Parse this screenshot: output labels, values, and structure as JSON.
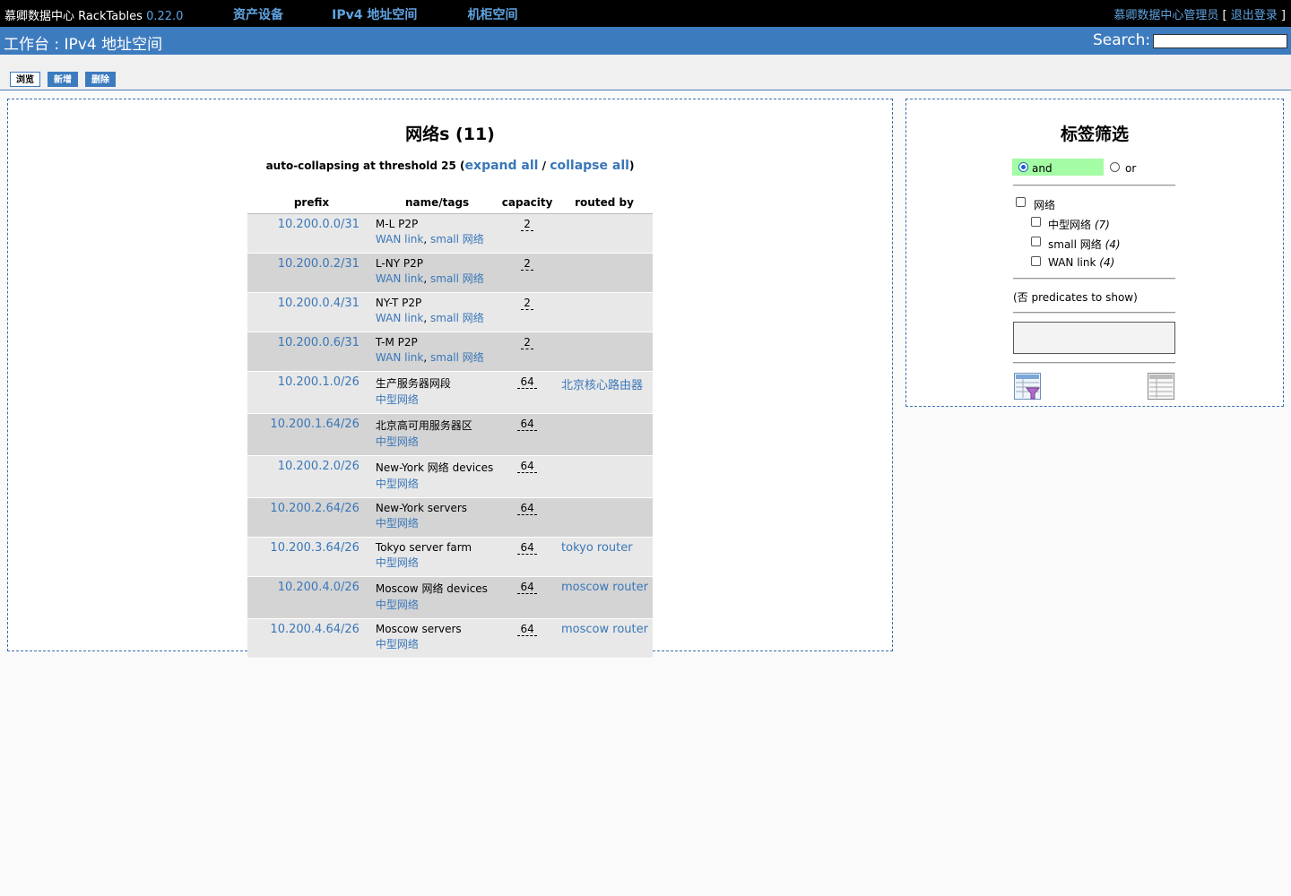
{
  "topbar": {
    "brand": "慕卿数据中心 RackTables",
    "version": "0.22.0",
    "nav": [
      "资产设备",
      "IPv4 地址空间",
      "机柜空间"
    ],
    "user": "慕卿数据中心管理员",
    "logout": "退出登录",
    "bracket_open": "[",
    "bracket_close": "]"
  },
  "header": {
    "title": "工作台 : IPv4 地址空间",
    "search_label": "Search:",
    "search_value": ""
  },
  "tabs": [
    {
      "label": "浏览",
      "active": true
    },
    {
      "label": "新增",
      "active": false
    },
    {
      "label": "删除",
      "active": false
    }
  ],
  "main": {
    "heading": "网络s (11)",
    "collapse_prefix": "auto-collapsing at threshold 25 (",
    "expand_all": "expand all",
    "slash": " / ",
    "collapse_all": "collapse all",
    "collapse_suffix": ")",
    "columns": [
      "prefix",
      "name/tags",
      "capacity",
      "routed by"
    ],
    "rows": [
      {
        "prefix": "10.200.0.0/31",
        "name": "M-L P2P",
        "tag1": "WAN link",
        "tag2": "small 网络",
        "capacity": "2",
        "routed_by": ""
      },
      {
        "prefix": "10.200.0.2/31",
        "name": "L-NY P2P",
        "tag1": "WAN link",
        "tag2": "small 网络",
        "capacity": "2",
        "routed_by": ""
      },
      {
        "prefix": "10.200.0.4/31",
        "name": "NY-T P2P",
        "tag1": "WAN link",
        "tag2": "small 网络",
        "capacity": "2",
        "routed_by": ""
      },
      {
        "prefix": "10.200.0.6/31",
        "name": "T-M P2P",
        "tag1": "WAN link",
        "tag2": "small 网络",
        "capacity": "2",
        "routed_by": ""
      },
      {
        "prefix": "10.200.1.0/26",
        "name": "生产服务器网段",
        "tag1": "中型网络",
        "tag2": "",
        "capacity": "64",
        "routed_by": "北京核心路由器"
      },
      {
        "prefix": "10.200.1.64/26",
        "name": "北京高可用服务器区",
        "tag1": "中型网络",
        "tag2": "",
        "capacity": "64",
        "routed_by": ""
      },
      {
        "prefix": "10.200.2.0/26",
        "name": "New-York 网络 devices",
        "tag1": "中型网络",
        "tag2": "",
        "capacity": "64",
        "routed_by": ""
      },
      {
        "prefix": "10.200.2.64/26",
        "name": "New-York servers",
        "tag1": "中型网络",
        "tag2": "",
        "capacity": "64",
        "routed_by": ""
      },
      {
        "prefix": "10.200.3.64/26",
        "name": "Tokyo server farm",
        "tag1": "中型网络",
        "tag2": "",
        "capacity": "64",
        "routed_by": "tokyo router"
      },
      {
        "prefix": "10.200.4.0/26",
        "name": "Moscow 网络 devices",
        "tag1": "中型网络",
        "tag2": "",
        "capacity": "64",
        "routed_by": "moscow router"
      },
      {
        "prefix": "10.200.4.64/26",
        "name": "Moscow servers",
        "tag1": "中型网络",
        "tag2": "",
        "capacity": "64",
        "routed_by": "moscow router"
      }
    ]
  },
  "sidebar": {
    "heading": "标签筛选",
    "and_label": "and",
    "or_label": "or",
    "root_tag": "网络",
    "sub_tags": [
      {
        "label": "中型网络",
        "count": "(7)"
      },
      {
        "label": "small 网络",
        "count": "(4)"
      },
      {
        "label": "WAN link",
        "count": "(4)"
      }
    ],
    "predicates_note": "(否 predicates to show)"
  }
}
